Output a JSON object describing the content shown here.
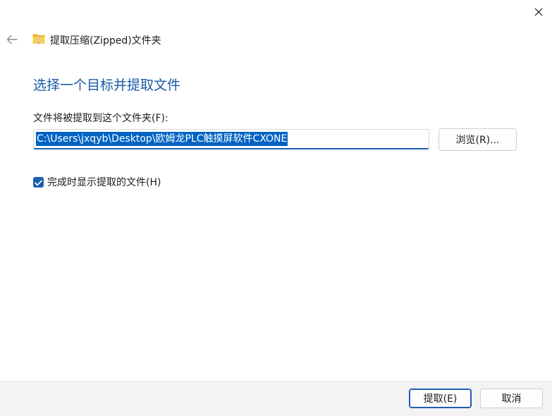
{
  "window": {
    "title": "提取压缩(Zipped)文件夹",
    "icons": {
      "close": "close-icon",
      "back": "back-arrow-icon",
      "folder": "zip-folder-icon",
      "check": "check-icon"
    }
  },
  "main": {
    "heading": "选择一个目标并提取文件",
    "path_label": "文件将被提取到这个文件夹(F):",
    "path_value": "C:\\Users\\jxqyb\\Desktop\\欧姆龙PLC触摸屏软件CXONE",
    "browse_label": "浏览(R)...",
    "show_files_label": "完成时显示提取的文件(H)",
    "show_files_checked": true
  },
  "footer": {
    "extract_label": "提取(E)",
    "cancel_label": "取消"
  },
  "colors": {
    "accent": "#1d5fb0",
    "heading": "#1a5aa6",
    "selection": "#0063c4",
    "footer_bg": "#f3f3f3"
  }
}
